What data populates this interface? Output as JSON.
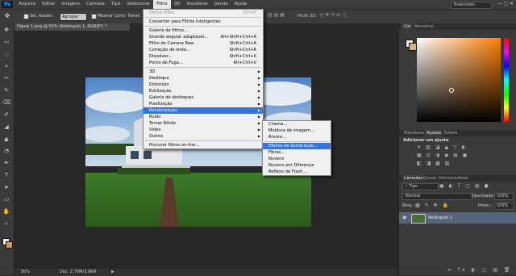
{
  "menubar": {
    "logo": "Ps",
    "items": [
      "Arquivo",
      "Editar",
      "Imagem",
      "Camada",
      "Tipo",
      "Selecionar",
      "Filtro",
      "3D",
      "Visualizar",
      "Janela",
      "Ajuda"
    ],
    "active_index": 6,
    "workspace": "Essenciais"
  },
  "options": {
    "auto_select_label": "Sel. Autom.:",
    "auto_select_value": "Agrupar",
    "show_transform_label": "Mostrar Contr. Transf.",
    "mode_3d_label": "Modo 3D:"
  },
  "document": {
    "tab_title": "Figura 1.png @ 50% (Retângulo 1, RGB/8*) *",
    "zoom": "50%",
    "doc_info": "Doc: 2,75M/3,96M"
  },
  "filter_menu": {
    "items": [
      {
        "label": "Último Filtro",
        "shortcut": "Ctrl+F",
        "disabled": true
      },
      {
        "sep": true
      },
      {
        "label": "Converter para Filtros Inteligentes"
      },
      {
        "sep": true
      },
      {
        "label": "Galeria de filtros..."
      },
      {
        "label": "Grande angular adaptável...",
        "shortcut": "Alt+Shift+Ctrl+A"
      },
      {
        "label": "Filtro do Camera Raw",
        "shortcut": "Shift+Ctrl+A"
      },
      {
        "label": "Correção de lente...",
        "shortcut": "Shift+Ctrl+R"
      },
      {
        "label": "Dissolver...",
        "shortcut": "Shift+Ctrl+X"
      },
      {
        "label": "Ponto de Fuga...",
        "shortcut": "Alt+Ctrl+V"
      },
      {
        "sep": true
      },
      {
        "label": "3D",
        "submenu": true
      },
      {
        "label": "Desfoque",
        "submenu": true
      },
      {
        "label": "Distorção",
        "submenu": true
      },
      {
        "label": "Estilização",
        "submenu": true
      },
      {
        "label": "Galeria de desfoques",
        "submenu": true
      },
      {
        "label": "Pixelização",
        "submenu": true
      },
      {
        "label": "Renderização",
        "submenu": true,
        "highlighted": true
      },
      {
        "label": "Ruído",
        "submenu": true
      },
      {
        "label": "Tornar Nítido",
        "submenu": true
      },
      {
        "label": "Vídeo",
        "submenu": true
      },
      {
        "label": "Outros",
        "submenu": true
      },
      {
        "sep": true
      },
      {
        "label": "Procurar filtros on-line..."
      }
    ]
  },
  "render_submenu": {
    "items": [
      {
        "label": "Chama..."
      },
      {
        "label": "Moldura de imagem..."
      },
      {
        "label": "Árvore..."
      },
      {
        "sep": true
      },
      {
        "label": "Efeitos de Iluminação...",
        "highlighted": true
      },
      {
        "label": "Fibras..."
      },
      {
        "label": "Nuvens"
      },
      {
        "label": "Nuvens por Diferença"
      },
      {
        "label": "Reflexo de Flash..."
      }
    ]
  },
  "color_panel": {
    "tabs": [
      "Cor",
      "Amostras"
    ]
  },
  "adjust_panel": {
    "tabs": [
      "Bibliotecas",
      "Ajustes",
      "Estilos"
    ],
    "title": "Adicionar um ajuste"
  },
  "layers_panel": {
    "tabs": [
      "Camadas",
      "Canais",
      "Demarcadores"
    ],
    "filter": "Tipo",
    "blend_mode": "Normal",
    "opacity_label": "Opacidade:",
    "opacity": "100%",
    "lock_label": "Bloq.:",
    "fill_label": "Preen.:",
    "fill": "100%",
    "layer_name": "Retângulo 1"
  },
  "colors": {
    "accent": "#3874d8",
    "menu_bg": "#f0f0f0",
    "app_bg": "#282828",
    "panel_bg": "#3a3a3a"
  }
}
